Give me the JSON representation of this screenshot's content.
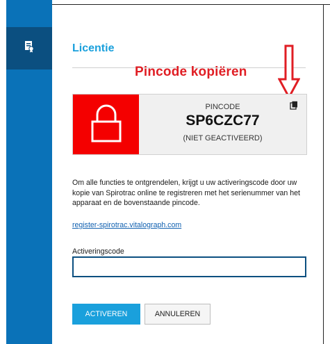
{
  "app": {
    "sidebar": {
      "active_item_icon": "license-certificate-icon"
    }
  },
  "dialog": {
    "title": "Licentie",
    "annotation": "Pincode kopiëren",
    "pin": {
      "label": "PINCODE",
      "code": "SP6CZC77",
      "status": "(NIET GEACTIVEERD)",
      "copy_icon": "copy-icon"
    },
    "description": "Om alle functies te ontgrendelen, krijgt u uw activeringscode door uw kopie van Spirotrac online te registreren met het serienummer van het apparaat en de bovenstaande pincode.",
    "link": "register-spirotrac.vitalograph.com",
    "activation_field": {
      "label": "Activeringscode",
      "value": "",
      "placeholder": ""
    },
    "buttons": {
      "activate": "ACTIVEREN",
      "cancel": "ANNULEREN"
    }
  },
  "colors": {
    "sidebar": "#0a72b8",
    "sidebar_active": "#0b4f80",
    "accent": "#1aa0dc",
    "lock_red": "#f40000",
    "annotation_red": "#e01e24"
  }
}
